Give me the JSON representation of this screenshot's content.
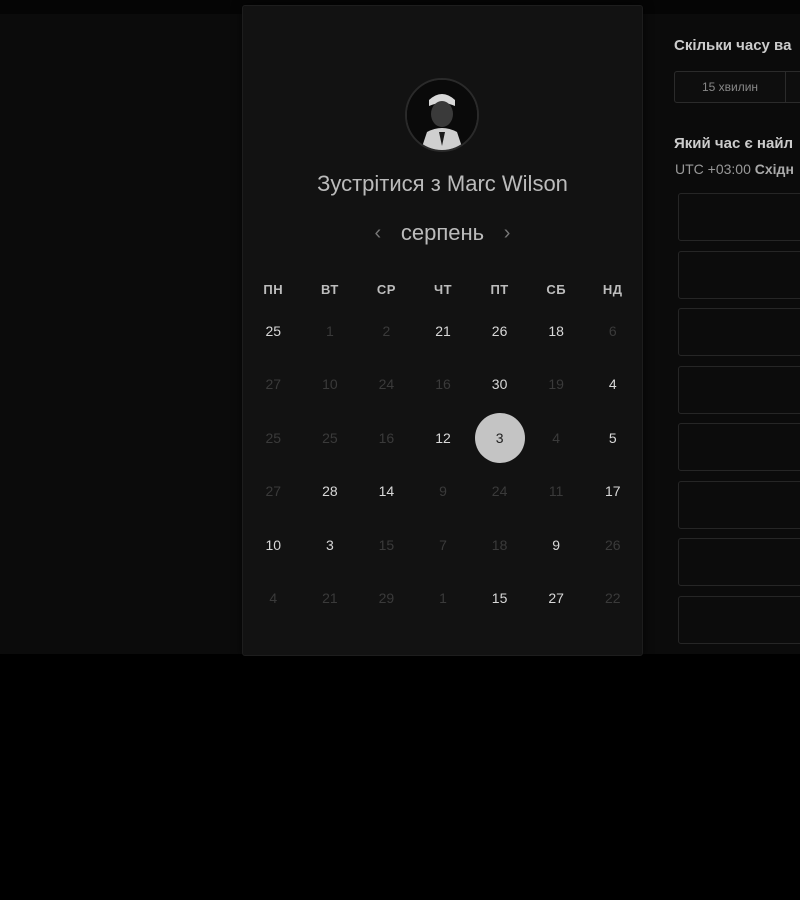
{
  "booking": {
    "title_prefix": "Зустрітися з",
    "host_name": "Marc Wilson",
    "month": "серпень",
    "weekdays": [
      "ПН",
      "ВТ",
      "СР",
      "ЧТ",
      "ПТ",
      "СБ",
      "НД"
    ],
    "weeks": [
      [
        {
          "n": "25",
          "s": "active"
        },
        {
          "n": "1",
          "s": "inactive"
        },
        {
          "n": "2",
          "s": "inactive"
        },
        {
          "n": "21",
          "s": "active"
        },
        {
          "n": "26",
          "s": "active"
        },
        {
          "n": "18",
          "s": "active"
        },
        {
          "n": "6",
          "s": "inactive"
        }
      ],
      [
        {
          "n": "27",
          "s": "inactive"
        },
        {
          "n": "10",
          "s": "inactive"
        },
        {
          "n": "24",
          "s": "inactive"
        },
        {
          "n": "16",
          "s": "inactive"
        },
        {
          "n": "30",
          "s": "active"
        },
        {
          "n": "19",
          "s": "inactive"
        },
        {
          "n": "4",
          "s": "active"
        }
      ],
      [
        {
          "n": "25",
          "s": "inactive"
        },
        {
          "n": "25",
          "s": "inactive"
        },
        {
          "n": "16",
          "s": "inactive"
        },
        {
          "n": "12",
          "s": "active"
        },
        {
          "n": "3",
          "s": "selected"
        },
        {
          "n": "4",
          "s": "inactive"
        },
        {
          "n": "5",
          "s": "active"
        }
      ],
      [
        {
          "n": "27",
          "s": "inactive"
        },
        {
          "n": "28",
          "s": "active"
        },
        {
          "n": "14",
          "s": "active"
        },
        {
          "n": "9",
          "s": "inactive"
        },
        {
          "n": "24",
          "s": "inactive"
        },
        {
          "n": "11",
          "s": "inactive"
        },
        {
          "n": "17",
          "s": "active"
        }
      ],
      [
        {
          "n": "10",
          "s": "active"
        },
        {
          "n": "3",
          "s": "active"
        },
        {
          "n": "15",
          "s": "inactive"
        },
        {
          "n": "7",
          "s": "inactive"
        },
        {
          "n": "18",
          "s": "inactive"
        },
        {
          "n": "9",
          "s": "active"
        },
        {
          "n": "26",
          "s": "inactive"
        }
      ],
      [
        {
          "n": "4",
          "s": "inactive"
        },
        {
          "n": "21",
          "s": "inactive"
        },
        {
          "n": "29",
          "s": "inactive"
        },
        {
          "n": "1",
          "s": "inactive"
        },
        {
          "n": "15",
          "s": "active"
        },
        {
          "n": "27",
          "s": "active"
        },
        {
          "n": "22",
          "s": "inactive"
        }
      ]
    ]
  },
  "sidebar": {
    "duration_question": "Скільки часу ва",
    "duration_option": "15 хвилин",
    "time_question": "Який час є найл",
    "tz_offset": "UTC +03:00",
    "tz_name": "Східн",
    "slot_count": 8
  },
  "icons": {
    "prev": "chevron-left-icon",
    "next": "chevron-right-icon"
  },
  "colors": {
    "background": "#0b0b0b",
    "card": "#121212",
    "selected_day": "#c4c4c4"
  }
}
